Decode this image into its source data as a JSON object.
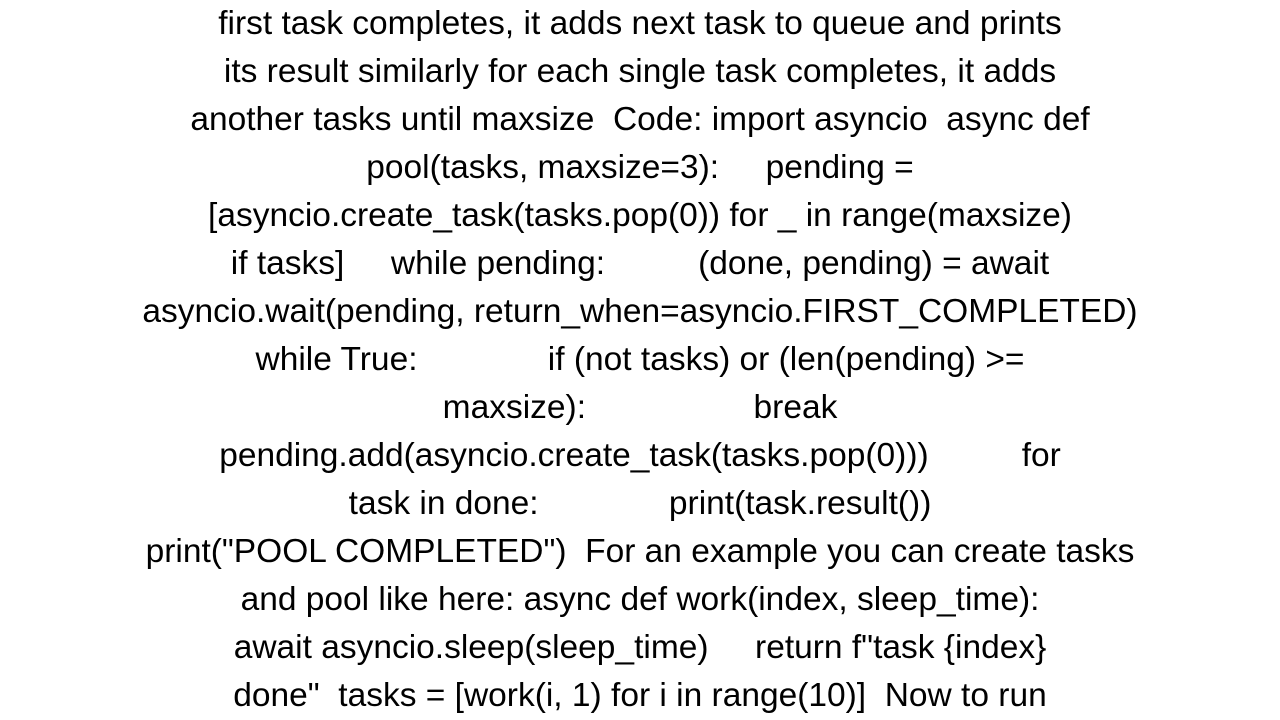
{
  "body_text": "first task completes, it adds next task to queue and prints\nits result similarly for each single task completes, it adds\nanother tasks until maxsize  Code: import asyncio  async def\npool(tasks, maxsize=3):     pending =\n[asyncio.create_task(tasks.pop(0)) for _ in range(maxsize)\nif tasks]     while pending:          (done, pending) = await\nasyncio.wait(pending, return_when=asyncio.FIRST_COMPLETED)\nwhile True:              if (not tasks) or (len(pending) >=\nmaxsize):                  break\npending.add(asyncio.create_task(tasks.pop(0)))          for\ntask in done:              print(task.result())\nprint(\"POOL COMPLETED\")  For an example you can create tasks\nand pool like here: async def work(index, sleep_time):\nawait asyncio.sleep(sleep_time)     return f\"task {index}\ndone\"  tasks = [work(i, 1) for i in range(10)]  Now to run"
}
